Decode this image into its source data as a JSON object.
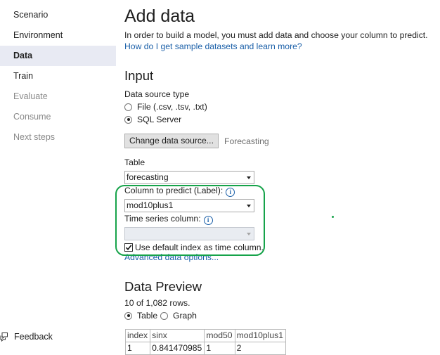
{
  "sidebar": {
    "items": [
      {
        "label": "Scenario",
        "state": "normal"
      },
      {
        "label": "Environment",
        "state": "normal"
      },
      {
        "label": "Data",
        "state": "active"
      },
      {
        "label": "Train",
        "state": "normal"
      },
      {
        "label": "Evaluate",
        "state": "disabled"
      },
      {
        "label": "Consume",
        "state": "disabled"
      },
      {
        "label": "Next steps",
        "state": "disabled"
      }
    ],
    "feedback_label": "Feedback"
  },
  "page": {
    "title": "Add data",
    "intro": "In order to build a model, you must add data and choose your column to predict.",
    "help_link": "How do I get sample datasets and learn more?"
  },
  "input": {
    "heading": "Input",
    "data_source_label": "Data source type",
    "options": [
      {
        "label": "File (.csv, .tsv, .txt)",
        "selected": false
      },
      {
        "label": "SQL Server",
        "selected": true
      }
    ],
    "change_button": "Change data source...",
    "source_name": "Forecasting",
    "table_label": "Table",
    "table_value": "forecasting",
    "column_label": "Column to predict (Label):",
    "column_value": "mod10plus1",
    "time_series_label": "Time series column:",
    "time_series_value": "",
    "use_default_index_label": "Use default index as time column.",
    "use_default_index_checked": true,
    "advanced_link": "Advanced data options..."
  },
  "preview": {
    "heading": "Data Preview",
    "rows_info": "10 of 1,082 rows.",
    "view_options": [
      {
        "label": "Table",
        "selected": true
      },
      {
        "label": "Graph",
        "selected": false
      }
    ],
    "columns": [
      "index",
      "sinx",
      "mod50",
      "mod10plus1"
    ],
    "rows": [
      [
        "1",
        "0.841470985",
        "1",
        "2"
      ]
    ]
  },
  "colors": {
    "accent_link": "#1a5fa8",
    "highlight_outline": "#16a34a",
    "active_nav_bg": "#e8eaf3"
  },
  "icons": {
    "feedback": "feedback-icon",
    "info": "info-icon",
    "dropdown": "chevron-down-icon",
    "check": "check-icon"
  }
}
